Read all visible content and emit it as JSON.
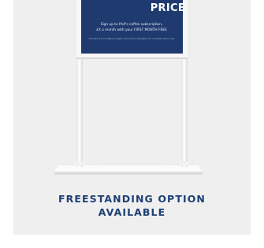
{
  "sign": {
    "title": "PRICE",
    "line1": "Sign up to Prof's coffee subscription,",
    "line2": "£X a month with your FIRST MONTH FREE",
    "fine_print": "*All terms & conditions apply. Promotion available for a limited time only."
  },
  "caption": {
    "line1": "FREESTANDING OPTION",
    "line2": "AVAILABLE"
  },
  "colors": {
    "card_background": "#f0efef",
    "sign_panel": "#1f3a6e",
    "caption_text": "#1c3f75",
    "stand_white": "#ffffff"
  }
}
